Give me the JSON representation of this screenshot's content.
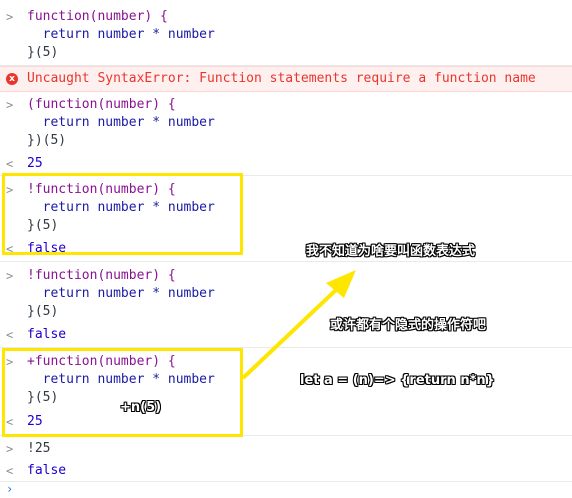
{
  "entries": [
    {
      "prompt": ">",
      "lines": [
        "function(number) {",
        "  return number * number",
        "}(5)"
      ]
    },
    {
      "error": "Uncaught SyntaxError: Function statements require a function name"
    },
    {
      "prompt": ">",
      "lines": [
        "(function(number) {",
        "  return number * number",
        "})(5)"
      ],
      "result": "25"
    },
    {
      "prompt": ">",
      "lines": [
        "!function(number) {",
        "  return number * number",
        "}(5)"
      ],
      "result": "false"
    },
    {
      "prompt": ">",
      "lines": [
        "!function(number) {",
        "  return number * number",
        "}(5)"
      ],
      "result": "false"
    },
    {
      "prompt": ">",
      "lines": [
        "+function(number) {",
        "  return number * number",
        "}(5)"
      ],
      "result": "25"
    },
    {
      "prompt": ">",
      "lines": [
        "!25"
      ],
      "result": "false"
    }
  ],
  "result_marker": "<",
  "error_icon": "x",
  "annotations": {
    "note1": "我不知道为啥要叫函数表达式",
    "note2": "或许都有个隐式的操作符吧",
    "note3": "let a = (n)=> {return n*n}",
    "note4": "+n(5)"
  },
  "colors": {
    "highlight": "#ffe600",
    "error": "#e8362d",
    "keyword": "#881391",
    "number": "#1a1aa6"
  }
}
